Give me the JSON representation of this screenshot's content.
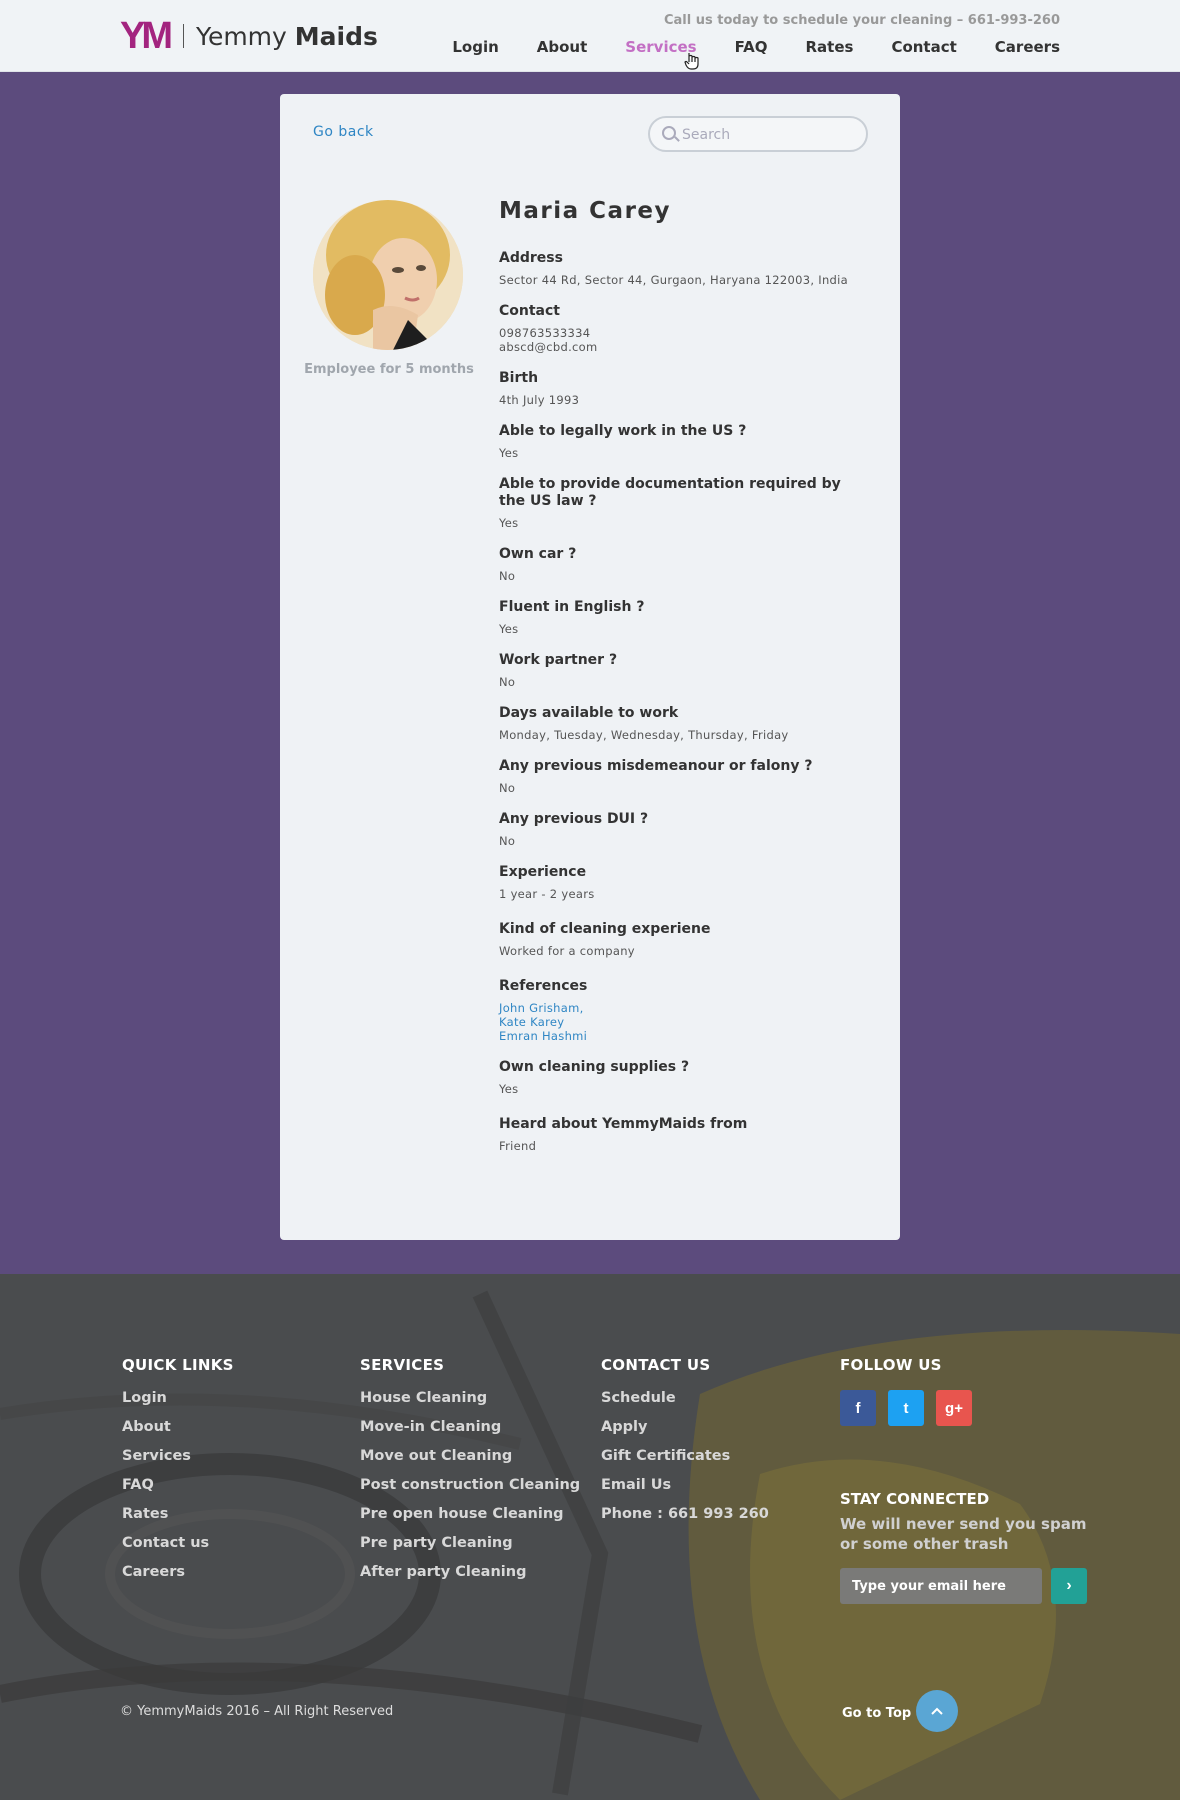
{
  "header": {
    "logo_mark": "YM",
    "brand_light": "Yemmy",
    "brand_bold": "Maids",
    "callus": "Call us today to schedule your cleaning – 661-993-260",
    "nav": [
      "Login",
      "About",
      "Services",
      "FAQ",
      "Rates",
      "Contact",
      "Careers"
    ],
    "active_nav": "Services"
  },
  "card": {
    "goback": "Go back",
    "search_placeholder": "Search",
    "tenure": "Employee for 5 months",
    "name": "Maria Carey",
    "fields": [
      {
        "label": "Address",
        "value": "Sector 44 Rd, Sector 44, Gurgaon, Haryana 122003, India"
      },
      {
        "label": "Contact",
        "value": "098763533334\nabscd@cbd.com"
      },
      {
        "label": "Birth",
        "value": "4th July 1993"
      },
      {
        "label": "Able to legally work in the US ?",
        "value": "Yes"
      },
      {
        "label": "Able to provide documentation required by the US law ?",
        "value": "Yes"
      },
      {
        "label": "Own car ?",
        "value": "No"
      },
      {
        "label": "Fluent in English ?",
        "value": "Yes"
      },
      {
        "label": "Work partner ?",
        "value": "No"
      },
      {
        "label": "Days available to work",
        "value": "Monday, Tuesday, Wednesday, Thursday, Friday"
      },
      {
        "label": "Any previous misdemeanour or falony ?",
        "value": "No"
      },
      {
        "label": "Any previous DUI ?",
        "value": "No"
      },
      {
        "label": "Experience",
        "value": "1 year - 2 years"
      },
      {
        "label": "Kind of cleaning experiene",
        "value": "Worked for a company"
      }
    ],
    "references_label": "References",
    "references": [
      "John Grisham,",
      "Kate Karey",
      "Emran Hashmi"
    ],
    "fields_after": [
      {
        "label": "Own cleaning supplies ?",
        "value": "Yes"
      },
      {
        "label": "Heard about YemmyMaids from",
        "value": "Friend"
      }
    ]
  },
  "footer": {
    "quick_links_title": "QUICK LINKS",
    "quick_links": [
      "Login",
      "About",
      "Services",
      "FAQ",
      "Rates",
      "Contact us",
      "Careers"
    ],
    "services_title": "SERVICES",
    "services": [
      "House Cleaning",
      "Move-in Cleaning",
      "Move out Cleaning",
      "Post construction Cleaning",
      "Pre open house Cleaning",
      "Pre party Cleaning",
      "After party Cleaning"
    ],
    "contact_title": "CONTACT US",
    "contact": [
      "Schedule",
      "Apply",
      "Gift Certificates",
      "Email Us",
      "Phone : 661 993 260"
    ],
    "follow_title": "FOLLOW US",
    "social": {
      "facebook": "f",
      "twitter": "t",
      "google": "g+"
    },
    "stay_title": "STAY CONNECTED",
    "stay_sub": "We will never send you spam or some other trash",
    "email_placeholder": "Type your email here",
    "submit_icon": "›",
    "copyright": "© YemmyMaids 2016 – All Right Reserved",
    "gototop": "Go to Top",
    "gototop_icon": "^"
  }
}
